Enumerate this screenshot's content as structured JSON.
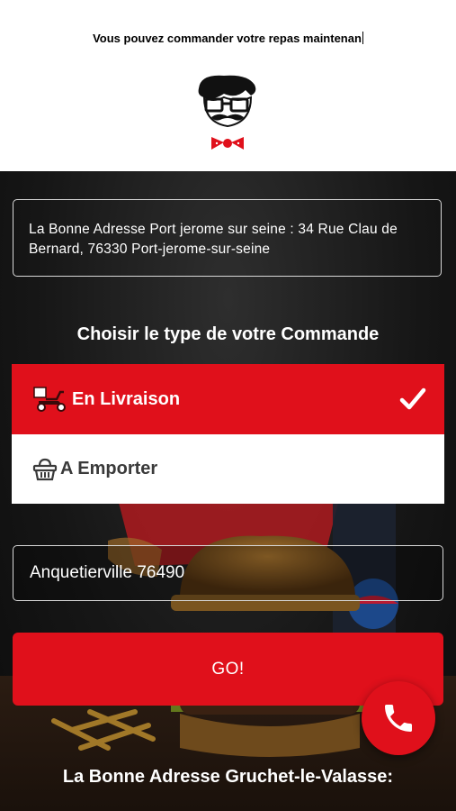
{
  "header": {
    "ticker_text": "Vous pouvez commander votre repas maintenan"
  },
  "selected_store_address": "La Bonne Adresse Port jerome sur seine : 34 Rue Clau de Bernard, 76330 Port-jerome-sur-seine",
  "order_type": {
    "title": "Choisir le type de votre Commande",
    "options": [
      {
        "label": "En Livraison",
        "icon": "scooter-icon",
        "selected": true
      },
      {
        "label": "A Emporter",
        "icon": "basket-icon",
        "selected": false
      }
    ]
  },
  "city_input": {
    "value": "Anquetierville 76490"
  },
  "go_label": "GO!",
  "call_icon": "phone-icon",
  "next_store_title": "La Bonne Adresse Gruchet-le-Valasse:",
  "colors": {
    "accent_red": "#e0101b",
    "header_bg": "#ffffff",
    "hero_bg": "#161616"
  }
}
